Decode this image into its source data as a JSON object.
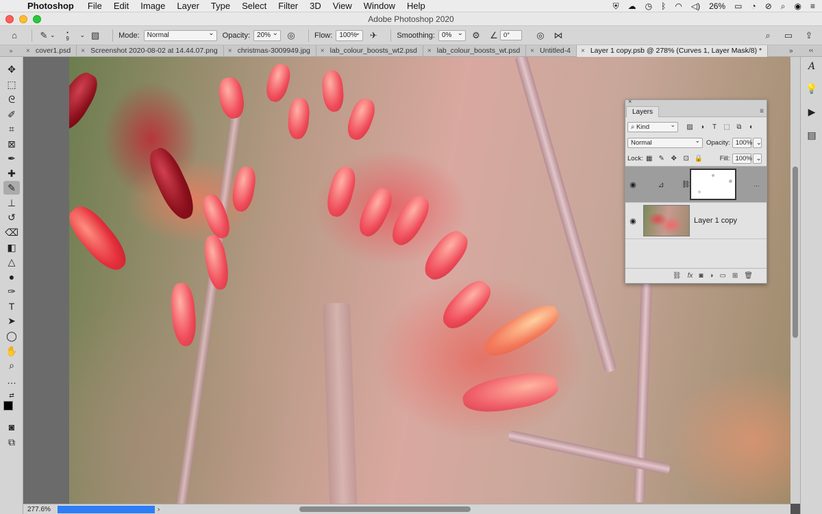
{
  "menubar": {
    "items": [
      "Photoshop",
      "File",
      "Edit",
      "Image",
      "Layer",
      "Type",
      "Select",
      "Filter",
      "3D",
      "View",
      "Window",
      "Help"
    ],
    "battery": "26%"
  },
  "window": {
    "title": "Adobe Photoshop 2020"
  },
  "options": {
    "brush_size": "9",
    "mode_label": "Mode:",
    "mode_value": "Normal",
    "opacity_label": "Opacity:",
    "opacity_value": "20%",
    "flow_label": "Flow:",
    "flow_value": "100%",
    "smoothing_label": "Smoothing:",
    "smoothing_value": "0%",
    "angle_value": "0°"
  },
  "tabs": [
    "cover1.psd",
    "Screenshot 2020-08-02 at 14.44.07.png",
    "christmas-3009949.jpg",
    "lab_colour_boosts_wt2.psd",
    "lab_colour_boosts_wt.psd",
    "Untitled-4",
    "Layer 1 copy.psb @ 278% (Curves 1, Layer Mask/8) *"
  ],
  "status": {
    "zoom": "277.6%"
  },
  "layers_panel": {
    "tab": "Layers",
    "filter_kind": "Kind",
    "blend_mode": "Normal",
    "opacity_label": "Opacity:",
    "opacity_value": "100%",
    "lock_label": "Lock:",
    "fill_label": "Fill:",
    "fill_value": "100%",
    "layers": [
      {
        "name": "",
        "type": "curves-adjustment",
        "selected": true
      },
      {
        "name": "Layer 1 copy",
        "type": "pixel",
        "selected": false
      }
    ]
  }
}
